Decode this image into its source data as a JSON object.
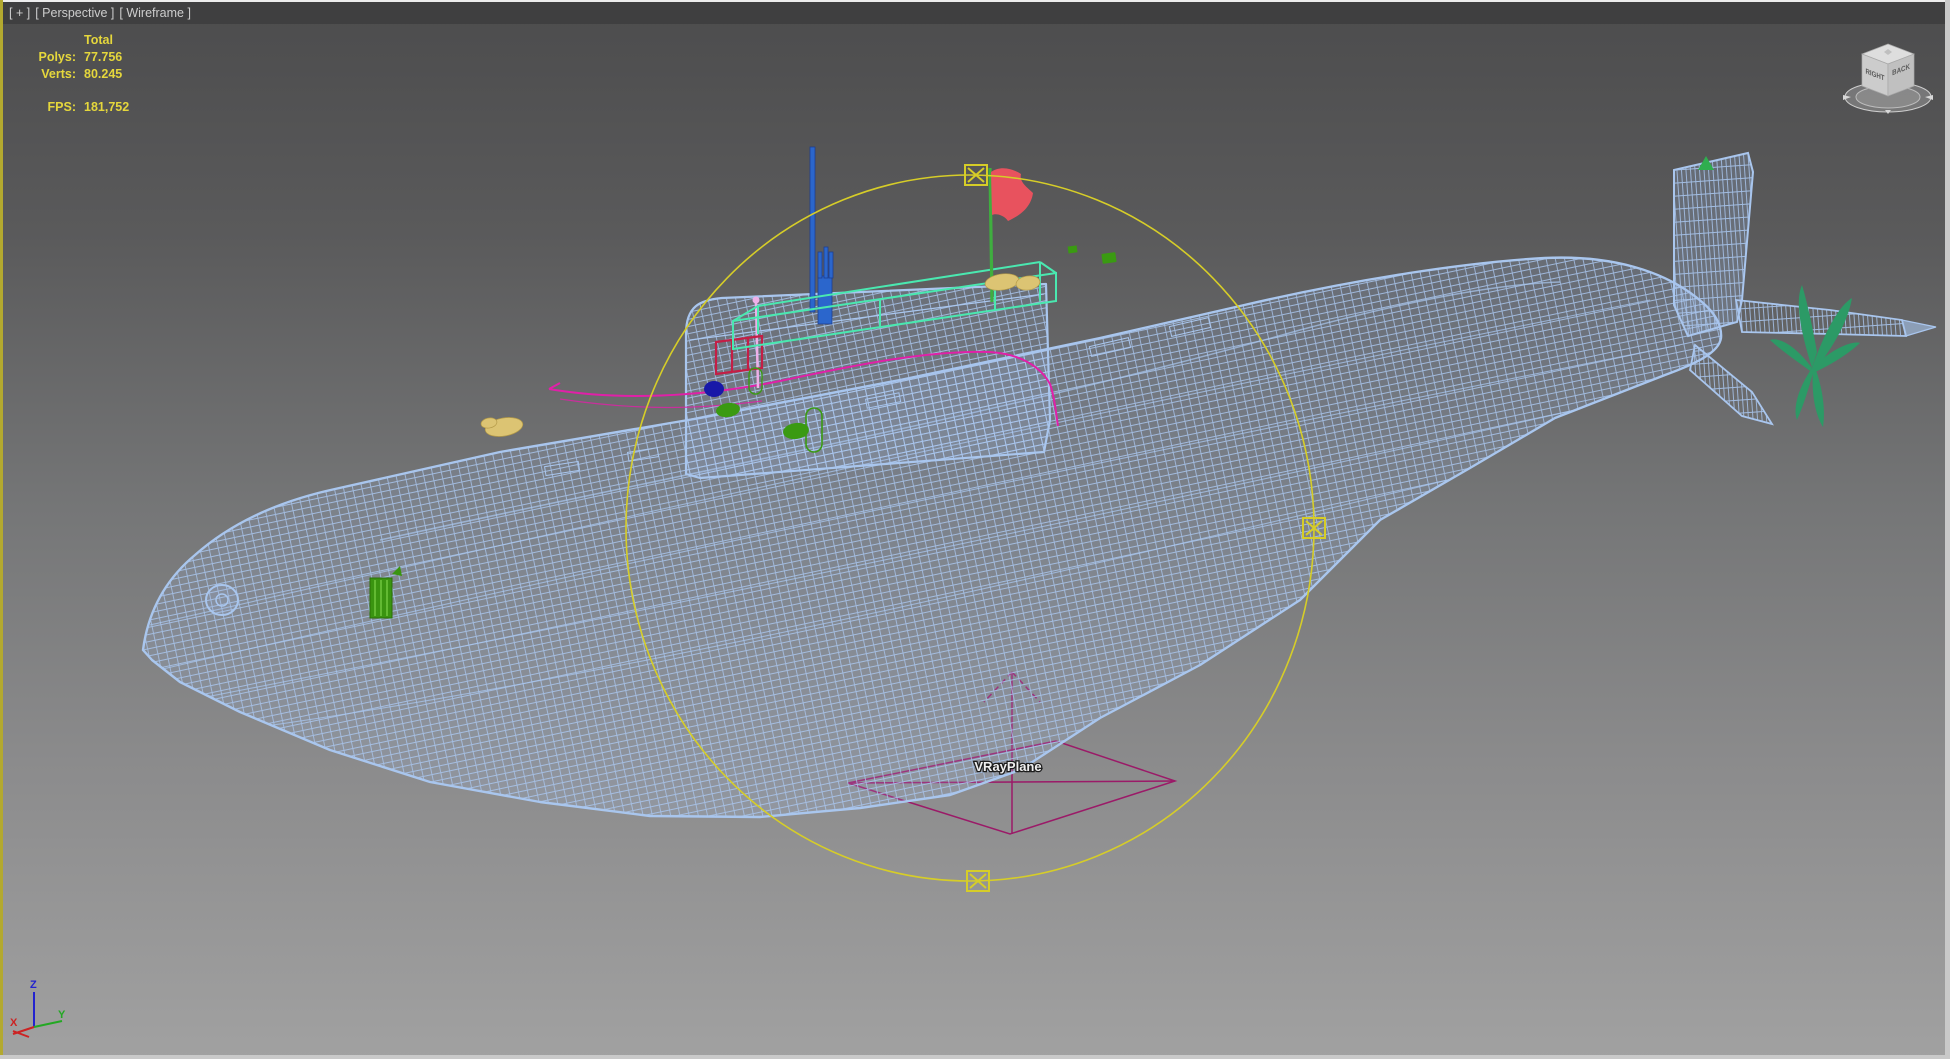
{
  "viewport": {
    "menus": {
      "general": "[ + ]",
      "pov": "[ Perspective ]",
      "shading": "[ Wireframe ]"
    },
    "stats": {
      "total_header": "Total",
      "polys_label": "Polys:",
      "polys_value": "77.756",
      "verts_label": "Verts:",
      "verts_value": "80.245",
      "fps_label": "FPS:",
      "fps_value": "181,752"
    },
    "scene": {
      "object_label": "VRayPlane"
    },
    "viewcube": {
      "right_face": "RIGHT",
      "back_face": "BACK"
    },
    "axis_gizmo": {
      "x": "X",
      "y": "Y",
      "z": "Z"
    },
    "colors": {
      "wireframe_blue": "#a9c6ee",
      "selection_yellow": "#d6cd28",
      "stats_yellow": "#e5d73c",
      "vray_gizmo_magenta": "#9b1a68",
      "sail_line_magenta": "#e020a8",
      "railing_teal": "#4ae8b0",
      "mast_blue": "#2b66cc",
      "flag_red": "#e8525e",
      "deck_green": "#3a9a12",
      "palm_green": "#2c9a66",
      "active_border_yellow": "#b3a92f"
    }
  }
}
